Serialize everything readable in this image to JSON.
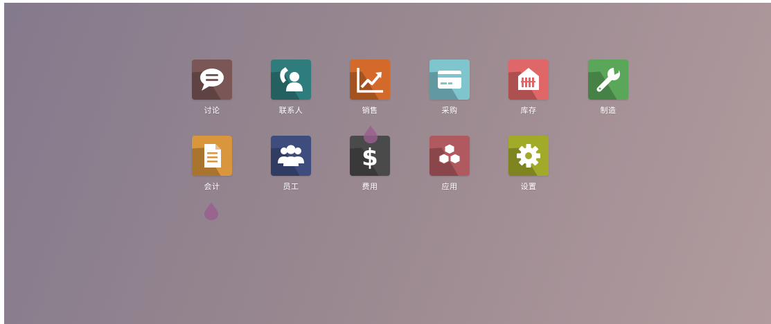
{
  "apps": [
    {
      "label": "讨论",
      "icon": "chat-bubble-icon",
      "color": "#7a5656"
    },
    {
      "label": "联系人",
      "icon": "contact-phone-icon",
      "color": "#2f7c7c"
    },
    {
      "label": "销售",
      "icon": "sales-chart-icon",
      "color": "#d36a2a"
    },
    {
      "label": "采购",
      "icon": "credit-card-icon",
      "color": "#7ec5cd"
    },
    {
      "label": "库存",
      "icon": "warehouse-icon",
      "color": "#df6767"
    },
    {
      "label": "制造",
      "icon": "wrench-icon",
      "color": "#5aa75a"
    },
    {
      "label": "会计",
      "icon": "document-icon",
      "color": "#d9963c"
    },
    {
      "label": "员工",
      "icon": "people-icon",
      "color": "#3e4d7e"
    },
    {
      "label": "费用",
      "icon": "dollar-icon",
      "color": "#4a4a4a"
    },
    {
      "label": "应用",
      "icon": "cubes-icon",
      "color": "#b05a60"
    },
    {
      "label": "设置",
      "icon": "gear-icon",
      "color": "#a2aa2a"
    }
  ],
  "decor": {
    "drop_color": "#9a5e8e"
  }
}
